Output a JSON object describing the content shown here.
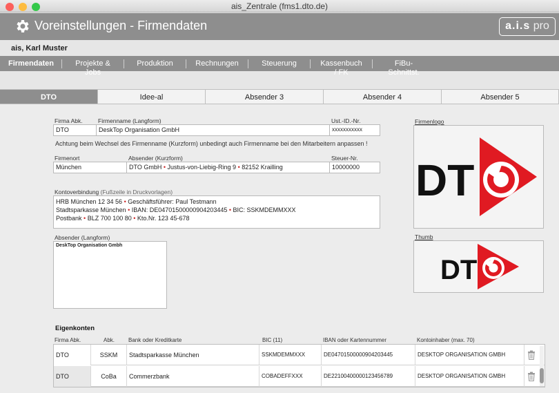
{
  "window": {
    "title": "ais_Zentrale (fms1.dto.de)"
  },
  "header": {
    "title": "Voreinstellungen - Firmendaten",
    "brand_bold": "a.i.s",
    "brand_light": "pro"
  },
  "user": {
    "name": "ais, Karl Muster"
  },
  "nav": {
    "items": [
      "Firmendaten",
      "Projekte & Jobs",
      "Produktion",
      "Rechnungen",
      "Steuerung",
      "Kassenbuch / FK",
      "FiBu-Schnittst."
    ]
  },
  "subtabs": {
    "items": [
      "DTO",
      "Idee-al",
      "Absender 3",
      "Absender 4",
      "Absender 5"
    ]
  },
  "form": {
    "firma_abk_label": "Firma Abk.",
    "firma_abk": "DTO",
    "firmenname_label": "Firmenname (Langform)",
    "firmenname": "DeskTop Organisation GmbH",
    "ustid_label": "Ust.-ID.-Nr.",
    "ustid": "xxxxxxxxxxx",
    "warning": "Achtung beim Wechsel des Firmenname (Kurzform) unbedingt auch Firmenname bei den Mitarbeitern anpassen !",
    "firmenort_label": "Firmenort",
    "firmenort": "München",
    "absender_kurz_label": "Absender (Kurzform)",
    "absender_kurz_parts": [
      "DTO GmbH",
      "Justus-von-Liebig-Ring 9",
      "82152 Krailling"
    ],
    "steuer_label": "Steuer-Nr.",
    "steuer": "10000000",
    "konto_label": "Kontoverbindung",
    "konto_label_sub": "(Fußzeile in Druckvorlagen)",
    "konto_line1": [
      "HRB München 12 34 56",
      "Geschäftsführer: Paul Testmann"
    ],
    "konto_line2": [
      "Stadtsparkasse München",
      "IBAN: DE04701500000904203445",
      "BIC: SSKMDEMMXXX"
    ],
    "konto_line3": [
      "Postbank",
      "BLZ 700 100 80",
      "Kto.Nr. 123 45-678"
    ],
    "absender_lang_label": "Absender (Langform)",
    "absender_lang": "DeskTop Organisation Gmbh",
    "logo_label": "Firmenlogo",
    "thumb_label": "Thumb",
    "logo_text": "DT"
  },
  "accounts": {
    "title": "Eigenkonten",
    "headers": [
      "Firma Abk.",
      "Abk.",
      "Bank oder Kreditkarte",
      "BIC (11)",
      "IBAN oder Kartennummer",
      "Kontoinhaber (max. 70)"
    ],
    "rows": [
      {
        "firma": "DTO",
        "abk": "SSKM",
        "bank": "Stadtsparkasse München",
        "bic": "SSKMDEMMXXX",
        "iban": "DE04701500000904203445",
        "inhaber": "DESKTOP ORGANISATION GMBH"
      },
      {
        "firma": "DTO",
        "abk": "CoBa",
        "bank": "Commerzbank",
        "bic": "COBADEFFXXX",
        "iban": "DE22100400000123456789",
        "inhaber": "DESKTOP ORGANISATION GMBH"
      }
    ]
  },
  "colors": {
    "header_gray": "#8e8e8e",
    "logo_red": "#e01a22",
    "traffic": [
      "#fc605c",
      "#fdbc40",
      "#34c84a"
    ]
  },
  "icons": [
    "gear-icon",
    "trash-icon",
    "dto-logo"
  ]
}
